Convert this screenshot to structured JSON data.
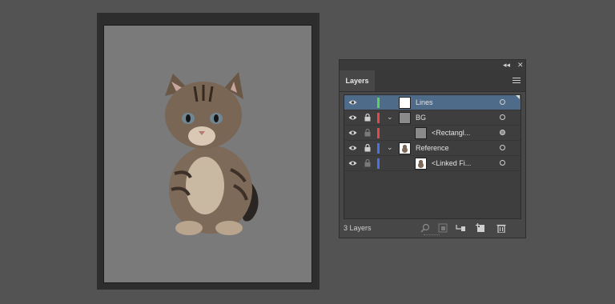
{
  "panel": {
    "collapse_icon": "◂◂",
    "close_icon": "✕",
    "tab_label": "Layers",
    "footer_count": "3 Layers"
  },
  "layers": [
    {
      "name": "Lines",
      "color": "#5ad35a",
      "thumb": "white",
      "selected": true,
      "lock_visible": false,
      "expanded": null,
      "indent": 0
    },
    {
      "name": "BG",
      "color": "#e24a4a",
      "thumb": "gray",
      "selected": false,
      "lock_visible": true,
      "expanded": true,
      "indent": 0
    },
    {
      "name": "<Rectangl...",
      "color": "#e24a4a",
      "thumb": "gray",
      "selected": false,
      "lock_visible": true,
      "expanded": null,
      "indent": 1
    },
    {
      "name": "Reference",
      "color": "#4a72e2",
      "thumb": "cat",
      "selected": false,
      "lock_visible": true,
      "expanded": true,
      "indent": 0
    },
    {
      "name": "<Linked Fi...",
      "color": "#4a72e2",
      "thumb": "cat",
      "selected": false,
      "lock_visible": true,
      "expanded": null,
      "indent": 1
    }
  ],
  "footer_icons": [
    "search-icon",
    "clipping-mask-icon",
    "sublayer-icon",
    "new-layer-icon",
    "trash-icon"
  ]
}
